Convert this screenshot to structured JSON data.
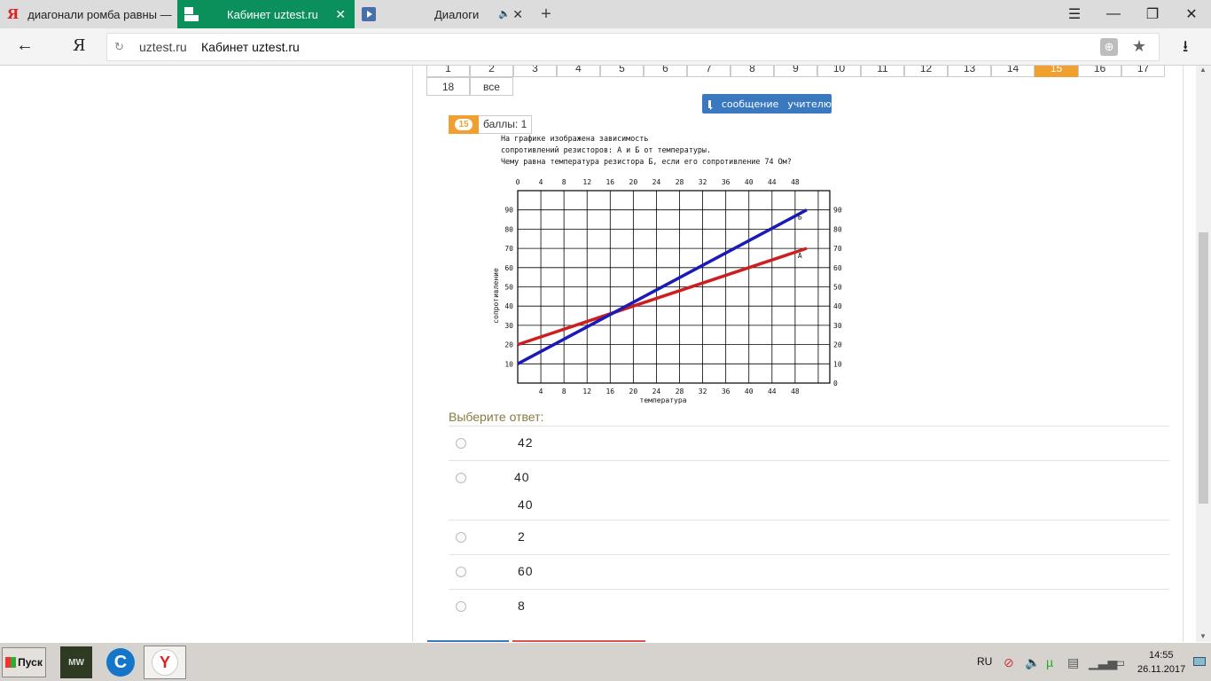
{
  "browser": {
    "tabs": [
      {
        "title": "диагонали ромба равны —",
        "favicon": "yandex-icon"
      },
      {
        "title": "Кабинет uztest.ru",
        "favicon": "uztest-icon",
        "active": true
      },
      {
        "title": "Диалоги",
        "favicon": "dialogs-icon"
      }
    ],
    "url_domain": "uztest.ru",
    "page_title": "Кабинет uztest.ru",
    "new_tab": "+",
    "win_menu": "☰",
    "win_min": "—",
    "win_max": "❐",
    "win_close": "✕",
    "back": "←",
    "yandex": "Я",
    "reload": "↻",
    "star": "★",
    "download": "⭳",
    "tab_close": "✕",
    "sound": "🔈",
    "globe": "⊕"
  },
  "qnav": {
    "row1": [
      "1",
      "2",
      "3",
      "4",
      "5",
      "6",
      "7",
      "8",
      "9",
      "10",
      "11",
      "12",
      "13",
      "14",
      "15",
      "16",
      "17"
    ],
    "row2": [
      "18",
      "все"
    ],
    "current": "15"
  },
  "message_button": {
    "word1": "сообщение",
    "word2": "учителю"
  },
  "question": {
    "number": "15",
    "points": "баллы: 1",
    "text_lines": [
      "На графике изображена зависимость",
      "сопротивлений резисторов: А и Б от температуры.",
      "Чему равна температура резистора Б, если его сопротивление 74 Ом?"
    ]
  },
  "chart_data": {
    "type": "line",
    "xlabel": "температура",
    "ylabel": "сопротивление",
    "x_ticks_top": [
      "0",
      "4",
      "8",
      "12",
      "16",
      "20",
      "24",
      "28",
      "32",
      "36",
      "40",
      "44",
      "48"
    ],
    "x_ticks_bottom": [
      "4",
      "8",
      "12",
      "16",
      "20",
      "24",
      "28",
      "32",
      "36",
      "40",
      "44",
      "48"
    ],
    "y_ticks_left": [
      "10",
      "20",
      "30",
      "40",
      "50",
      "60",
      "70",
      "80",
      "90"
    ],
    "y_ticks_right": [
      "0",
      "10",
      "20",
      "30",
      "40",
      "50",
      "60",
      "70",
      "80",
      "90"
    ],
    "xlim": [
      0,
      54
    ],
    "ylim": [
      0,
      100
    ],
    "grid": true,
    "series": [
      {
        "name": "А",
        "color": "#cc2020",
        "x": [
          0,
          50
        ],
        "y": [
          20,
          70
        ]
      },
      {
        "name": "Б",
        "color": "#1a1ab8",
        "x": [
          0,
          50
        ],
        "y": [
          10,
          90
        ]
      }
    ]
  },
  "answers": {
    "prompt": "Выберите ответ:",
    "options": [
      {
        "lines": [
          "42"
        ]
      },
      {
        "lines": [
          "40",
          "40"
        ]
      },
      {
        "lines": [
          "2"
        ]
      },
      {
        "lines": [
          "60"
        ]
      },
      {
        "lines": [
          "8"
        ]
      }
    ]
  },
  "taskbar": {
    "start": "Пуск",
    "mw_label": "MW",
    "ccl_label": "C",
    "ya_label": "Y",
    "lang": "RU",
    "time": "14:55",
    "date": "26.11.2017"
  }
}
